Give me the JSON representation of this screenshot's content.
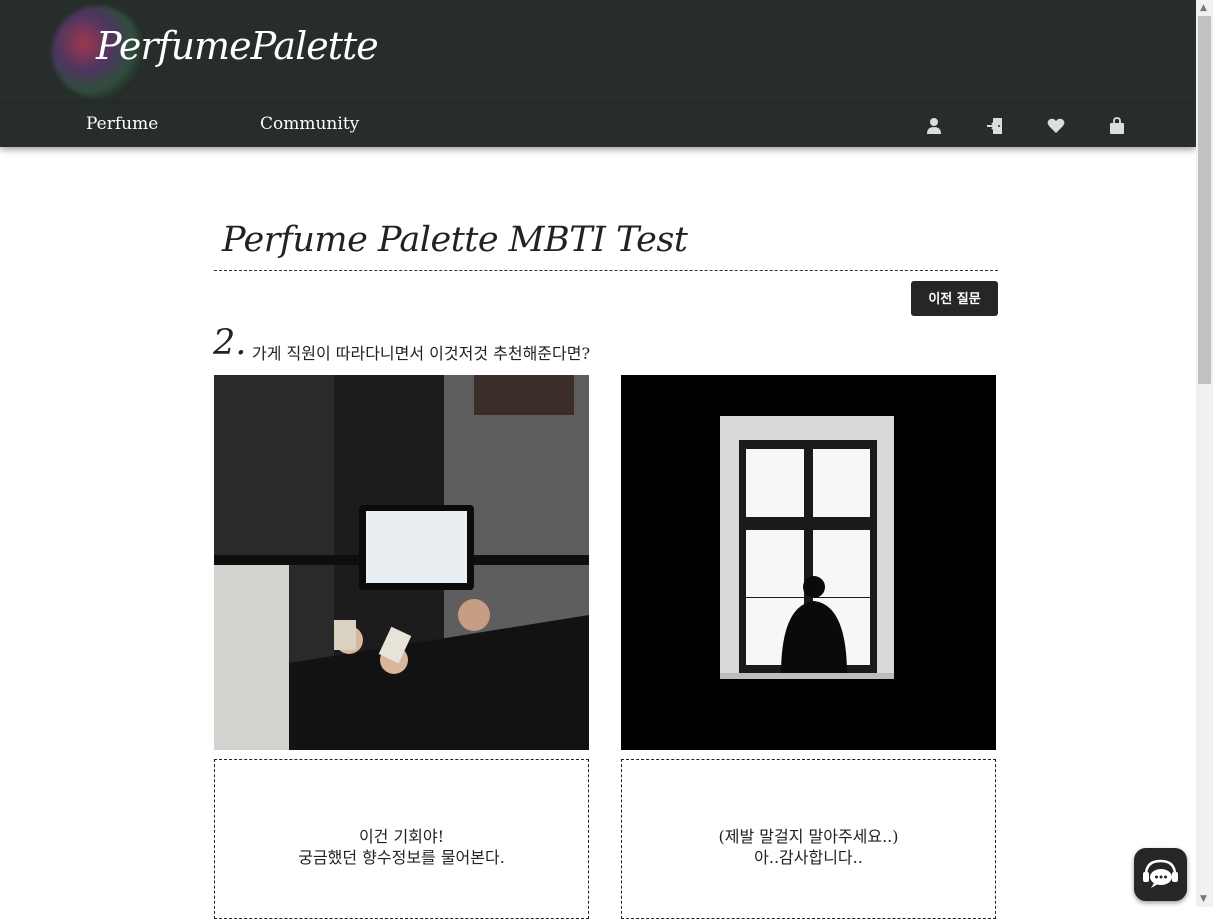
{
  "brand": {
    "logo_text": "PerfumePalette"
  },
  "nav": {
    "items": [
      {
        "label": "Perfume"
      },
      {
        "label": "Community"
      }
    ],
    "icons": [
      "user-icon",
      "login-door-icon",
      "heart-icon",
      "shopping-bag-icon"
    ]
  },
  "page": {
    "title": "Perfume Palette MBTI Test",
    "prev_button": "이전 질문"
  },
  "question": {
    "number": "2.",
    "text": "가게 직원이 따라다니면서 이것저것 추천해준다면?"
  },
  "choices": [
    {
      "image": "staff-showing-tablet-to-customer-photo",
      "line1": "이건 기회야!",
      "line2": "궁금했던 향수정보를 물어본다."
    },
    {
      "image": "man-silhouette-at-window-photo",
      "line1": "(제발 말걸지 말아주세요..)",
      "line2": "아..감사합니다.."
    }
  ],
  "chat": {
    "icon": "support-chat-icon"
  },
  "colors": {
    "header_bg": "#262d2b",
    "button_bg": "#262626",
    "text": "#222222"
  }
}
